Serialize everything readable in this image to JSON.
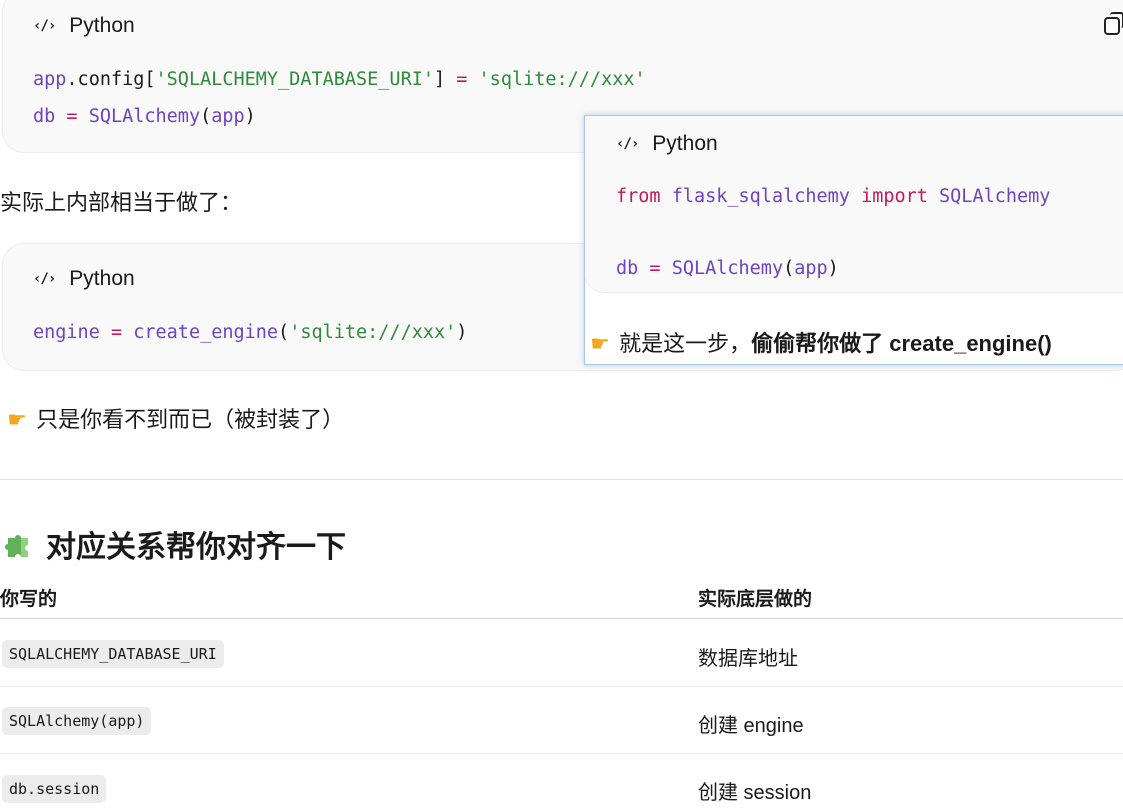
{
  "code_block_1": {
    "language": "Python",
    "lines": [
      [
        {
          "t": "app",
          "c": "var"
        },
        {
          "t": ".config[",
          "c": "plain"
        },
        {
          "t": "'SQLALCHEMY_DATABASE_URI'",
          "c": "str"
        },
        {
          "t": "] ",
          "c": "plain"
        },
        {
          "t": "=",
          "c": "op"
        },
        {
          "t": " ",
          "c": "plain"
        },
        {
          "t": "'sqlite:///xxx'",
          "c": "str"
        }
      ],
      [
        {
          "t": "db",
          "c": "var"
        },
        {
          "t": " ",
          "c": "plain"
        },
        {
          "t": "=",
          "c": "op"
        },
        {
          "t": " ",
          "c": "plain"
        },
        {
          "t": "SQLAlchemy",
          "c": "var"
        },
        {
          "t": "(",
          "c": "plain"
        },
        {
          "t": "app",
          "c": "var"
        },
        {
          "t": ")",
          "c": "plain"
        }
      ]
    ]
  },
  "para_1": "实际上内部相当于做了：",
  "code_block_2": {
    "language": "Python",
    "lines": [
      [
        {
          "t": "engine",
          "c": "var"
        },
        {
          "t": " ",
          "c": "plain"
        },
        {
          "t": "=",
          "c": "op"
        },
        {
          "t": " ",
          "c": "plain"
        },
        {
          "t": "create_engine",
          "c": "var"
        },
        {
          "t": "(",
          "c": "plain"
        },
        {
          "t": "'sqlite:///xxx'",
          "c": "str"
        },
        {
          "t": ")",
          "c": "plain"
        }
      ]
    ]
  },
  "para_2": "只是你看不到而已（被封装了）",
  "section": {
    "title": "对应关系帮你对齐一下"
  },
  "table": {
    "headers": [
      "你写的",
      "实际底层做的"
    ],
    "rows": [
      {
        "code": "SQLALCHEMY_DATABASE_URI",
        "desc": "数据库地址"
      },
      {
        "code": "SQLAlchemy(app)",
        "desc": "创建 engine"
      },
      {
        "code": "db.session",
        "desc": "创建 session"
      }
    ]
  },
  "popup": {
    "language": "Python",
    "lines": [
      [
        {
          "t": "from",
          "c": "kw"
        },
        {
          "t": " ",
          "c": "plain"
        },
        {
          "t": "flask_sqlalchemy",
          "c": "mod"
        },
        {
          "t": " ",
          "c": "plain"
        },
        {
          "t": "import",
          "c": "kw"
        },
        {
          "t": " ",
          "c": "plain"
        },
        {
          "t": "SQLAlchemy",
          "c": "mod"
        }
      ],
      [],
      [
        {
          "t": "db",
          "c": "var"
        },
        {
          "t": " ",
          "c": "plain"
        },
        {
          "t": "=",
          "c": "op"
        },
        {
          "t": " ",
          "c": "plain"
        },
        {
          "t": "SQLAlchemy",
          "c": "var"
        },
        {
          "t": "(",
          "c": "plain"
        },
        {
          "t": "app",
          "c": "var"
        },
        {
          "t": ")",
          "c": "plain"
        }
      ]
    ],
    "note_plain": "就是这一步，",
    "note_bold": "偷偷帮你做了 create_engine()"
  },
  "icons": {
    "code": "code-icon",
    "copy": "copy-icon",
    "point_right": "point-right-icon",
    "puzzle": "puzzle-icon"
  },
  "colors": {
    "string": "#2e8b3a",
    "variable": "#6f42c1",
    "keyword": "#c2185b",
    "puzzle": "#5fb25a",
    "emoji_hand": "#f3a51d"
  }
}
